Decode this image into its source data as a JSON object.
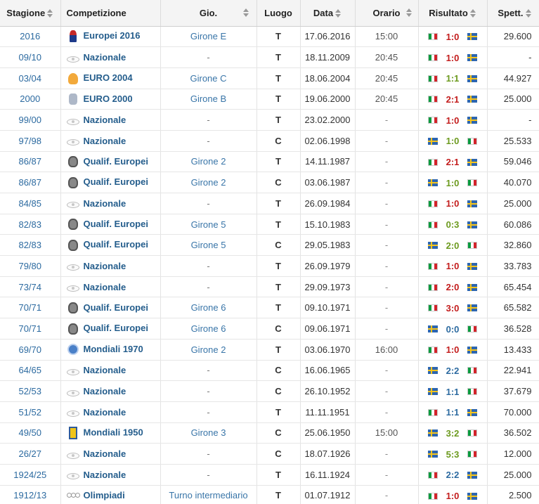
{
  "headers": {
    "stagione": "Stagione",
    "competizione": "Competizione",
    "gio": "Gio.",
    "luogo": "Luogo",
    "data": "Data",
    "orario": "Orario",
    "risultato": "Risultato",
    "spett": "Spett."
  },
  "colors": {
    "italy_win": "#c31c1c",
    "italy_loss": "#2c6aa0",
    "draw": "#6c9a1e",
    "link": "#245d8c",
    "header_bg": "#f4f4f4"
  },
  "rows": [
    {
      "stagione": "2016",
      "icon": "euro2016",
      "comp": "Europei 2016",
      "gio": "Girone E",
      "luogo": "T",
      "data": "17.06.2016",
      "orario": "15:00",
      "home_flag": "ita",
      "score": "1:0",
      "away_flag": "swe",
      "outcome": "win",
      "spett": "29.600"
    },
    {
      "stagione": "09/10",
      "icon": "nazionale",
      "comp": "Nazionale",
      "gio": "-",
      "luogo": "T",
      "data": "18.11.2009",
      "orario": "20:45",
      "home_flag": "ita",
      "score": "1:0",
      "away_flag": "swe",
      "outcome": "win",
      "spett": "-"
    },
    {
      "stagione": "03/04",
      "icon": "euro2004",
      "comp": "EURO 2004",
      "gio": "Girone C",
      "luogo": "T",
      "data": "18.06.2004",
      "orario": "20:45",
      "home_flag": "ita",
      "score": "1:1",
      "away_flag": "swe",
      "outcome": "draw",
      "spett": "44.927"
    },
    {
      "stagione": "2000",
      "icon": "euro2000",
      "comp": "EURO 2000",
      "gio": "Girone B",
      "luogo": "T",
      "data": "19.06.2000",
      "orario": "20:45",
      "home_flag": "ita",
      "score": "2:1",
      "away_flag": "swe",
      "outcome": "win",
      "spett": "25.000"
    },
    {
      "stagione": "99/00",
      "icon": "nazionale",
      "comp": "Nazionale",
      "gio": "-",
      "luogo": "T",
      "data": "23.02.2000",
      "orario": "-",
      "home_flag": "ita",
      "score": "1:0",
      "away_flag": "swe",
      "outcome": "win",
      "spett": "-"
    },
    {
      "stagione": "97/98",
      "icon": "nazionale",
      "comp": "Nazionale",
      "gio": "-",
      "luogo": "C",
      "data": "02.06.1998",
      "orario": "-",
      "home_flag": "swe",
      "score": "1:0",
      "away_flag": "ita",
      "outcome": "draw",
      "spett": "25.533"
    },
    {
      "stagione": "86/87",
      "icon": "qualif",
      "comp": "Qualif. Europei",
      "gio": "Girone 2",
      "luogo": "T",
      "data": "14.11.1987",
      "orario": "-",
      "home_flag": "ita",
      "score": "2:1",
      "away_flag": "swe",
      "outcome": "win",
      "spett": "59.046"
    },
    {
      "stagione": "86/87",
      "icon": "qualif",
      "comp": "Qualif. Europei",
      "gio": "Girone 2",
      "luogo": "C",
      "data": "03.06.1987",
      "orario": "-",
      "home_flag": "swe",
      "score": "1:0",
      "away_flag": "ita",
      "outcome": "draw",
      "spett": "40.070"
    },
    {
      "stagione": "84/85",
      "icon": "nazionale",
      "comp": "Nazionale",
      "gio": "-",
      "luogo": "T",
      "data": "26.09.1984",
      "orario": "-",
      "home_flag": "ita",
      "score": "1:0",
      "away_flag": "swe",
      "outcome": "win",
      "spett": "25.000"
    },
    {
      "stagione": "82/83",
      "icon": "qualif",
      "comp": "Qualif. Europei",
      "gio": "Girone 5",
      "luogo": "T",
      "data": "15.10.1983",
      "orario": "-",
      "home_flag": "ita",
      "score": "0:3",
      "away_flag": "swe",
      "outcome": "draw",
      "spett": "60.086"
    },
    {
      "stagione": "82/83",
      "icon": "qualif",
      "comp": "Qualif. Europei",
      "gio": "Girone 5",
      "luogo": "C",
      "data": "29.05.1983",
      "orario": "-",
      "home_flag": "swe",
      "score": "2:0",
      "away_flag": "ita",
      "outcome": "draw",
      "spett": "32.860"
    },
    {
      "stagione": "79/80",
      "icon": "nazionale",
      "comp": "Nazionale",
      "gio": "-",
      "luogo": "T",
      "data": "26.09.1979",
      "orario": "-",
      "home_flag": "ita",
      "score": "1:0",
      "away_flag": "swe",
      "outcome": "win",
      "spett": "33.783"
    },
    {
      "stagione": "73/74",
      "icon": "nazionale",
      "comp": "Nazionale",
      "gio": "-",
      "luogo": "T",
      "data": "29.09.1973",
      "orario": "-",
      "home_flag": "ita",
      "score": "2:0",
      "away_flag": "swe",
      "outcome": "win",
      "spett": "65.454"
    },
    {
      "stagione": "70/71",
      "icon": "qualif",
      "comp": "Qualif. Europei",
      "gio": "Girone 6",
      "luogo": "T",
      "data": "09.10.1971",
      "orario": "-",
      "home_flag": "ita",
      "score": "3:0",
      "away_flag": "swe",
      "outcome": "win",
      "spett": "65.582"
    },
    {
      "stagione": "70/71",
      "icon": "qualif",
      "comp": "Qualif. Europei",
      "gio": "Girone 6",
      "luogo": "C",
      "data": "09.06.1971",
      "orario": "-",
      "home_flag": "swe",
      "score": "0:0",
      "away_flag": "ita",
      "outcome": "loss",
      "spett": "36.528"
    },
    {
      "stagione": "69/70",
      "icon": "mondiali1970",
      "comp": "Mondiali 1970",
      "gio": "Girone 2",
      "luogo": "T",
      "data": "03.06.1970",
      "orario": "16:00",
      "home_flag": "ita",
      "score": "1:0",
      "away_flag": "swe",
      "outcome": "win",
      "spett": "13.433"
    },
    {
      "stagione": "64/65",
      "icon": "nazionale",
      "comp": "Nazionale",
      "gio": "-",
      "luogo": "C",
      "data": "16.06.1965",
      "orario": "-",
      "home_flag": "swe",
      "score": "2:2",
      "away_flag": "ita",
      "outcome": "loss",
      "spett": "22.941"
    },
    {
      "stagione": "52/53",
      "icon": "nazionale",
      "comp": "Nazionale",
      "gio": "-",
      "luogo": "C",
      "data": "26.10.1952",
      "orario": "-",
      "home_flag": "swe",
      "score": "1:1",
      "away_flag": "ita",
      "outcome": "loss",
      "spett": "37.679"
    },
    {
      "stagione": "51/52",
      "icon": "nazionale",
      "comp": "Nazionale",
      "gio": "-",
      "luogo": "T",
      "data": "11.11.1951",
      "orario": "-",
      "home_flag": "ita",
      "score": "1:1",
      "away_flag": "swe",
      "outcome": "loss",
      "spett": "70.000"
    },
    {
      "stagione": "49/50",
      "icon": "mondiali1950",
      "comp": "Mondiali 1950",
      "gio": "Girone 3",
      "luogo": "C",
      "data": "25.06.1950",
      "orario": "15:00",
      "home_flag": "swe",
      "score": "3:2",
      "away_flag": "ita",
      "outcome": "draw",
      "spett": "36.502"
    },
    {
      "stagione": "26/27",
      "icon": "nazionale",
      "comp": "Nazionale",
      "gio": "-",
      "luogo": "C",
      "data": "18.07.1926",
      "orario": "-",
      "home_flag": "swe",
      "score": "5:3",
      "away_flag": "ita",
      "outcome": "draw",
      "spett": "12.000"
    },
    {
      "stagione": "1924/25",
      "icon": "nazionale",
      "comp": "Nazionale",
      "gio": "-",
      "luogo": "T",
      "data": "16.11.1924",
      "orario": "-",
      "home_flag": "ita",
      "score": "2:2",
      "away_flag": "swe",
      "outcome": "loss",
      "spett": "25.000"
    },
    {
      "stagione": "1912/13",
      "icon": "olimpiadi",
      "comp": "Olimpiadi",
      "gio": "Turno intermediario",
      "luogo": "T",
      "data": "01.07.1912",
      "orario": "-",
      "home_flag": "ita",
      "score": "1:0",
      "away_flag": "swe",
      "outcome": "win",
      "spett": "2.500"
    }
  ]
}
